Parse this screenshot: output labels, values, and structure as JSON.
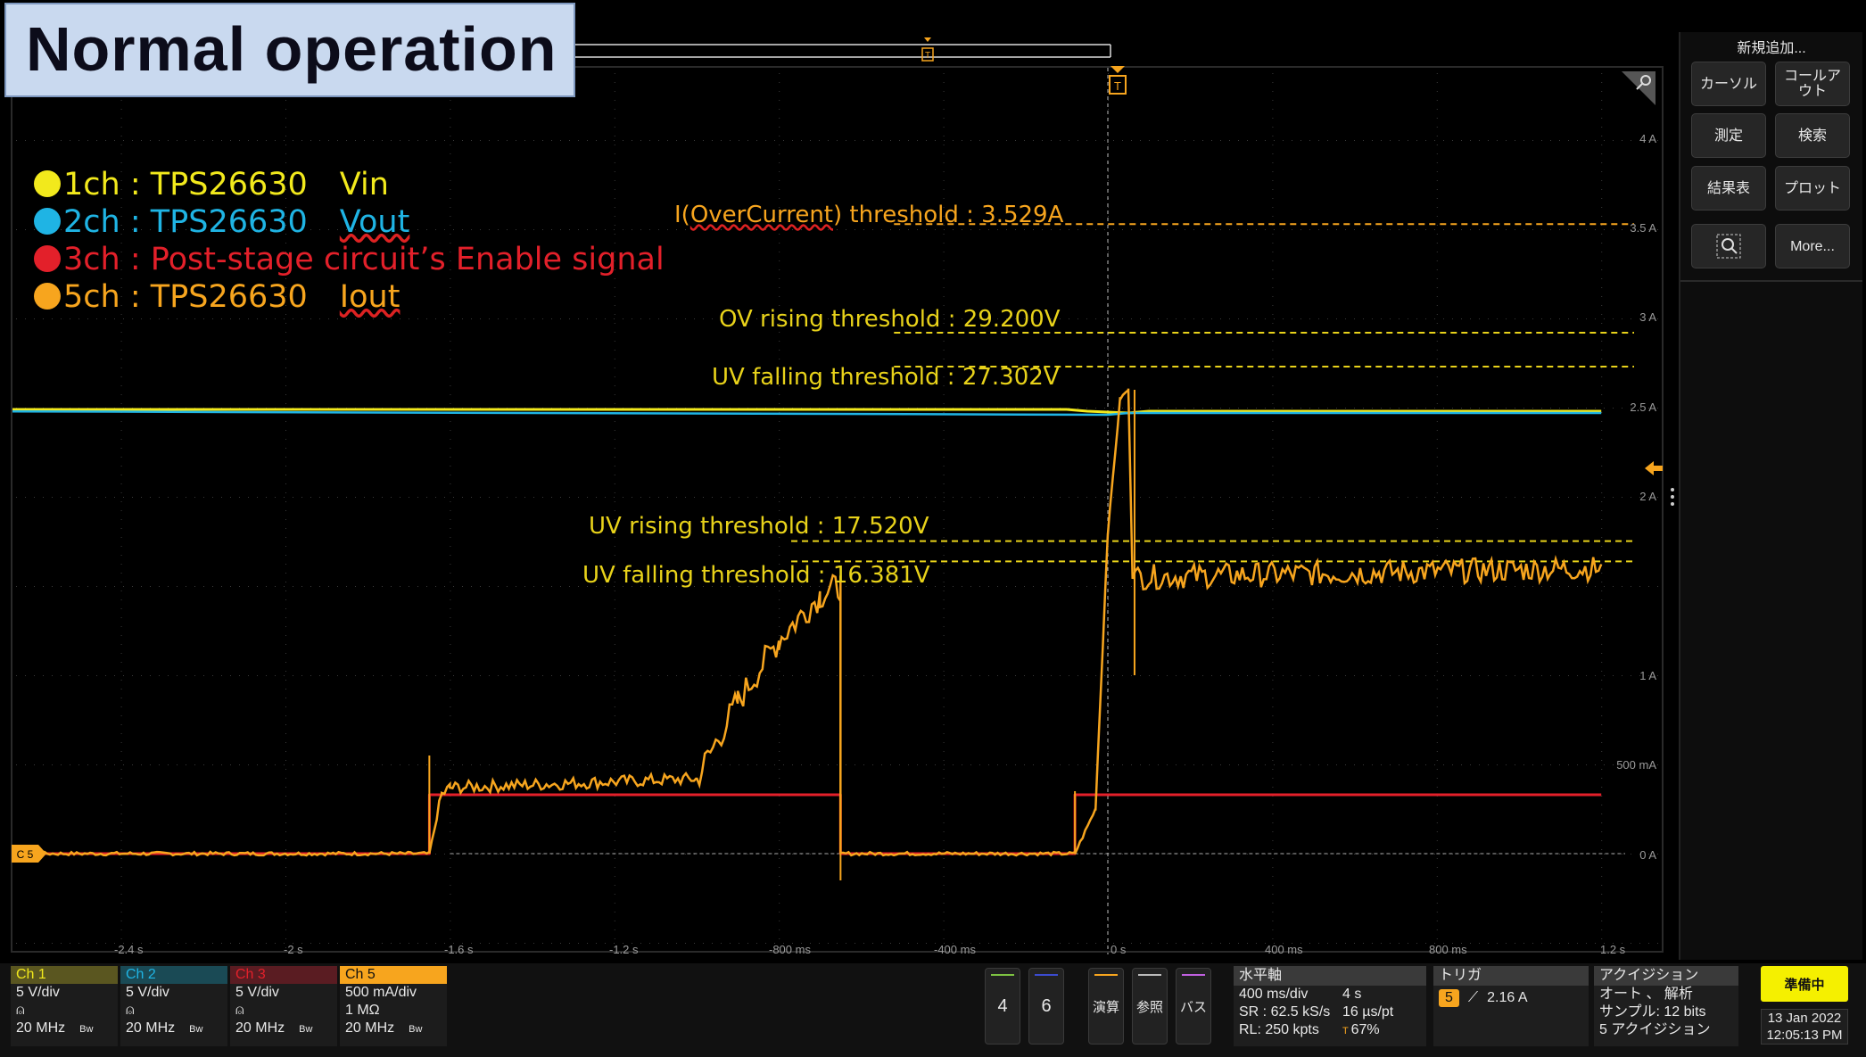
{
  "title": "Normal operation",
  "legend": [
    {
      "ch": "1ch",
      "sep": " : ",
      "device": "TPS26630",
      "signal": "Vin",
      "color": "#f2e91c",
      "underline": false
    },
    {
      "ch": "2ch",
      "sep": " : ",
      "device": "TPS26630",
      "signal": "Vout",
      "color": "#1fb4e4",
      "underline": true
    },
    {
      "ch": "3ch",
      "sep": " : ",
      "device": "Post-stage circuit’s Enable signal",
      "signal": "",
      "color": "#e3202a",
      "underline": false
    },
    {
      "ch": "5ch",
      "sep": " : ",
      "device": "TPS26630",
      "signal": "Iout",
      "color": "#f7a51e",
      "underline": true
    }
  ],
  "thresholds": {
    "oc": {
      "prefix": "I(",
      "underlined": "OverCurrent",
      "suffix": ") threshold : 3.529A",
      "color": "#f7a51e"
    },
    "ov_rise": "OV rising threshold : 29.200V",
    "uv_fall_hi": "UV falling threshold : 27.302V",
    "uv_rise": "UV rising threshold : 17.520V",
    "uv_fall_lo": "UV falling threshold : 16.381V"
  },
  "y_ticks": [
    "4 A",
    "3.5 A",
    "3 A",
    "2.5 A",
    "2 A",
    "1 A",
    "500 mA",
    "0 A"
  ],
  "x_ticks": [
    "-2.4 s",
    "-2 s",
    "-1.6 s",
    "-1.2 s",
    "-800 ms",
    "-400 ms",
    "0 s",
    "400 ms",
    "800 ms",
    "1.2 s"
  ],
  "markers": {
    "trigger": "T",
    "channel_ref": "C 5"
  },
  "chart_data": {
    "type": "line",
    "x_unit": "s",
    "xlim": [
      -2.8,
      1.2
    ],
    "y_unit": "A (Ch5 scale)",
    "ylim": [
      -1.0,
      4.4
    ],
    "series": [
      {
        "name": "Vin",
        "color": "#f2e91c",
        "x": [
          -2.8,
          -0.1,
          -0.05,
          0.05,
          0.1,
          1.2
        ],
        "y": [
          2.49,
          2.49,
          2.48,
          2.47,
          2.48,
          2.48
        ]
      },
      {
        "name": "Vout",
        "color": "#1fb4e4",
        "x": [
          -2.8,
          0.0,
          0.05,
          1.2
        ],
        "y": [
          2.48,
          2.46,
          2.47,
          2.47
        ]
      },
      {
        "name": "Post-stage circuit's Enable signal",
        "color": "#e3202a",
        "x": [
          -2.8,
          -1.65,
          -1.65,
          -0.65,
          -0.65,
          -0.08,
          -0.08,
          1.2
        ],
        "y": [
          0.0,
          0.0,
          0.33,
          0.33,
          0.0,
          0.0,
          0.33,
          0.33
        ]
      },
      {
        "name": "Iout",
        "color": "#f7a51e",
        "x": [
          -2.8,
          -1.65,
          -1.62,
          -1.6,
          -1.0,
          -0.9,
          -0.8,
          -0.7,
          -0.65,
          -0.65,
          -0.08,
          -0.03,
          0.0,
          0.03,
          0.05,
          0.06,
          1.2
        ],
        "y": [
          0.0,
          0.0,
          0.33,
          0.37,
          0.42,
          0.85,
          1.2,
          1.45,
          1.5,
          0.0,
          0.0,
          0.25,
          1.8,
          2.55,
          2.6,
          1.55,
          1.6
        ]
      }
    ],
    "threshold_levels": [
      3.529,
      2.92,
      2.73,
      1.752,
      1.638
    ]
  },
  "right_panel": {
    "header": "新規追加...",
    "buttons": [
      "カーソル",
      "コールアウト",
      "測定",
      "検索",
      "結果表",
      "プロット",
      "",
      "More..."
    ]
  },
  "bottom": {
    "channels": [
      {
        "name": "Ch 1",
        "l1": "5 V/div",
        "l3": "20 MHz",
        "color": "#f2e91c",
        "bg": "#5a5620"
      },
      {
        "name": "Ch 2",
        "l1": "5 V/div",
        "l3": "20 MHz",
        "color": "#1fb4e4",
        "bg": "#1a4a55"
      },
      {
        "name": "Ch 3",
        "l1": "5 V/div",
        "l3": "20 MHz",
        "color": "#e3202a",
        "bg": "#5a1c22"
      },
      {
        "name": "Ch 5",
        "l1": "500 mA/div",
        "l2": "1 MΩ",
        "l3": "20 MHz",
        "color": "#111",
        "bg": "#f7a51e"
      }
    ],
    "bw": "Bw",
    "soft_buttons": [
      {
        "label": "4",
        "color": "#7dc242"
      },
      {
        "label": "6",
        "color": "#3b4bcf"
      },
      {
        "label": "演算",
        "color": "#f7a51e"
      },
      {
        "label": "参照",
        "color": "#bbbbbb"
      },
      {
        "label": "バス",
        "color": "#c060e0"
      }
    ],
    "horizontal": {
      "title": "水平軸",
      "scale": "400 ms/div",
      "dur": "4 s",
      "sr": "SR :  62.5 kS/s",
      "pt": "16 µs/pt",
      "rl": "RL: 250 kpts",
      "pos": "67%"
    },
    "trigger": {
      "title": "トリガ",
      "src": "5",
      "level": "2.16 A"
    },
    "acq": {
      "title": "アクイジション",
      "mode": "オート 、   解析",
      "sample": "サンプル: 12 bits",
      "count": "5 アクイジション"
    },
    "status": "準備中",
    "date": "13 Jan 2022",
    "time": "12:05:13 PM"
  }
}
